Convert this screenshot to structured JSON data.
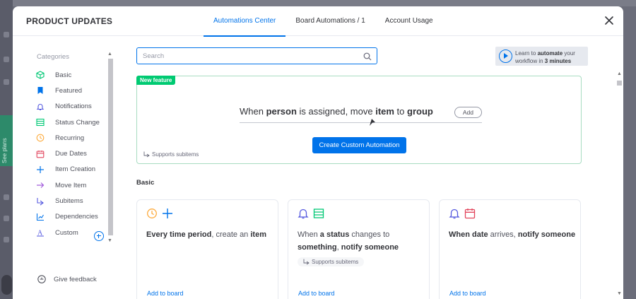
{
  "background": {
    "see_plans": "See plans"
  },
  "modal": {
    "title": "PRODUCT UPDATES",
    "tabs": [
      {
        "label": "Automations Center",
        "active": true
      },
      {
        "label": "Board Automations / 1",
        "active": false
      },
      {
        "label": "Account Usage",
        "active": false
      }
    ],
    "close_icon": "close-icon"
  },
  "sidebar": {
    "title": "Categories",
    "items": [
      {
        "label": "Basic",
        "icon": "cube-icon",
        "color": "#00c875"
      },
      {
        "label": "Featured",
        "icon": "bookmark-icon",
        "color": "#0073ea"
      },
      {
        "label": "Notifications",
        "icon": "bell-icon",
        "color": "#5559df"
      },
      {
        "label": "Status Change",
        "icon": "status-icon",
        "color": "#00c875"
      },
      {
        "label": "Recurring",
        "icon": "clock-icon",
        "color": "#fdab3d"
      },
      {
        "label": "Due Dates",
        "icon": "calendar-icon",
        "color": "#e2445c"
      },
      {
        "label": "Item Creation",
        "icon": "plus-icon",
        "color": "#0073ea"
      },
      {
        "label": "Move Item",
        "icon": "arrow-right-icon",
        "color": "#a25ddc"
      },
      {
        "label": "Subitems",
        "icon": "subitems-icon",
        "color": "#5559df"
      },
      {
        "label": "Dependencies",
        "icon": "dependencies-icon",
        "color": "#0073ea"
      },
      {
        "label": "Custom",
        "icon": "custom-icon",
        "color": "#5559df"
      }
    ],
    "feedback_label": "Give feedback"
  },
  "search": {
    "placeholder": "Search",
    "value": ""
  },
  "learn": {
    "line1_prefix": "Learn to ",
    "line1_bold": "automate",
    "line1_suffix": " your",
    "line2_prefix": "workflow in ",
    "line2_bold": "3 minutes"
  },
  "custom_automation": {
    "badge": "New feature",
    "sentence": {
      "w1": "When ",
      "b1": "person",
      "w2": " is assigned, move ",
      "b2": "item",
      "w3": " to ",
      "b3": "group"
    },
    "add_label": "Add",
    "button_label": "Create Custom Automation",
    "supports_subitems": "Supports subitems"
  },
  "basic_section": {
    "title": "Basic",
    "cards": [
      {
        "icons": [
          "clock-icon",
          "plus-icon"
        ],
        "parts": [
          {
            "t": "Every time period",
            "b": true
          },
          {
            "t": ", create an ",
            "b": false
          },
          {
            "t": "item",
            "b": true
          }
        ],
        "chip": "",
        "add_label": "Add to board"
      },
      {
        "icons": [
          "bell-icon",
          "status-icon"
        ],
        "parts": [
          {
            "t": "When ",
            "b": false
          },
          {
            "t": "a status",
            "b": true
          },
          {
            "t": " changes to ",
            "b": false
          },
          {
            "t": "something",
            "b": true
          },
          {
            "t": ", ",
            "b": false
          },
          {
            "t": "notify someone",
            "b": true
          }
        ],
        "chip": "Supports subitems",
        "add_label": "Add to board"
      },
      {
        "icons": [
          "bell-icon",
          "calendar-icon"
        ],
        "parts": [
          {
            "t": "When date",
            "b": true
          },
          {
            "t": " arrives, ",
            "b": false
          },
          {
            "t": "notify someone",
            "b": true
          }
        ],
        "chip": "",
        "add_label": "Add to board"
      }
    ]
  },
  "colors": {
    "accent": "#0073ea",
    "new_badge": "#00ca72"
  }
}
